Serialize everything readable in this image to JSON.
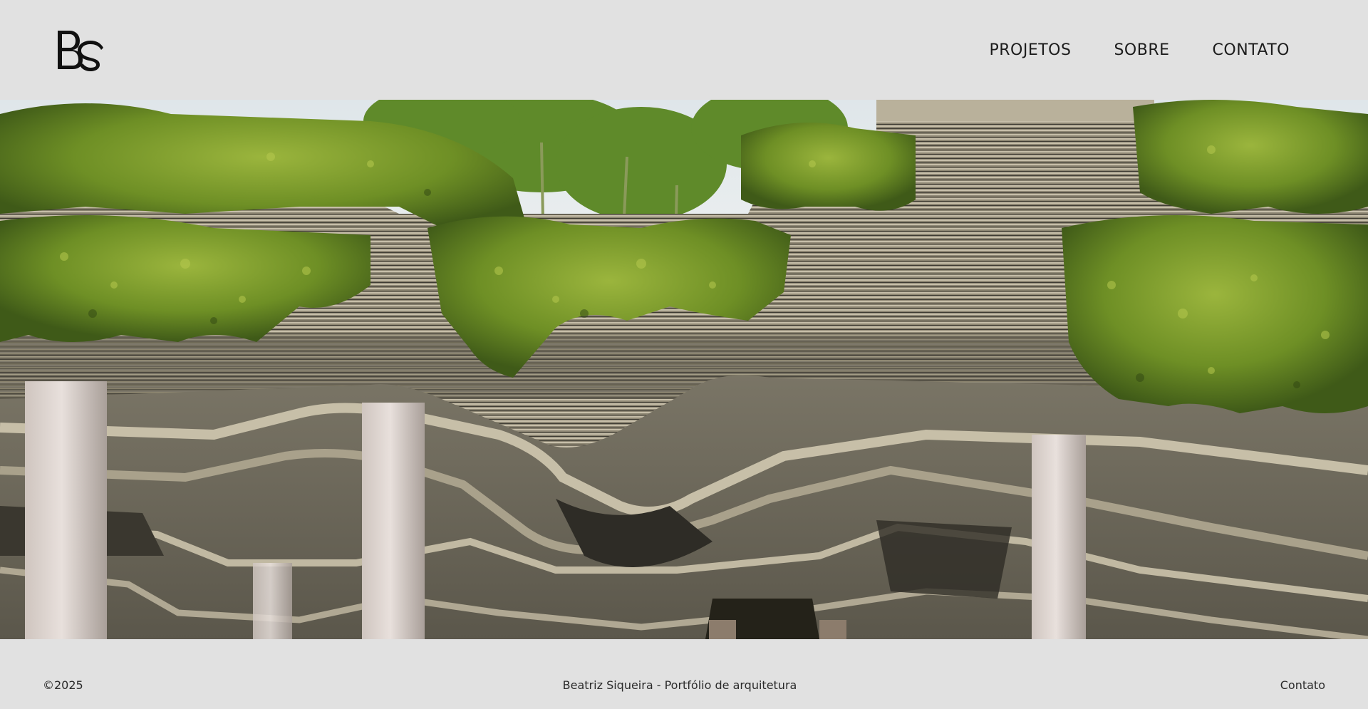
{
  "header": {
    "logo_text": "BS",
    "nav": [
      {
        "label": "PROJETOS"
      },
      {
        "label": "SOBRE"
      },
      {
        "label": "CONTATO"
      }
    ]
  },
  "hero": {
    "image_description_icon": "architecture-photo"
  },
  "footer": {
    "copyright": "©2025",
    "tagline": "Beatriz Siqueira - Portfólio de arquitetura",
    "contact_link": "Contato"
  },
  "colors": {
    "background": "#e1e1e1",
    "text": "#1a1a1a",
    "foliage": "#6f8f2c",
    "concrete": "#8a8472"
  }
}
